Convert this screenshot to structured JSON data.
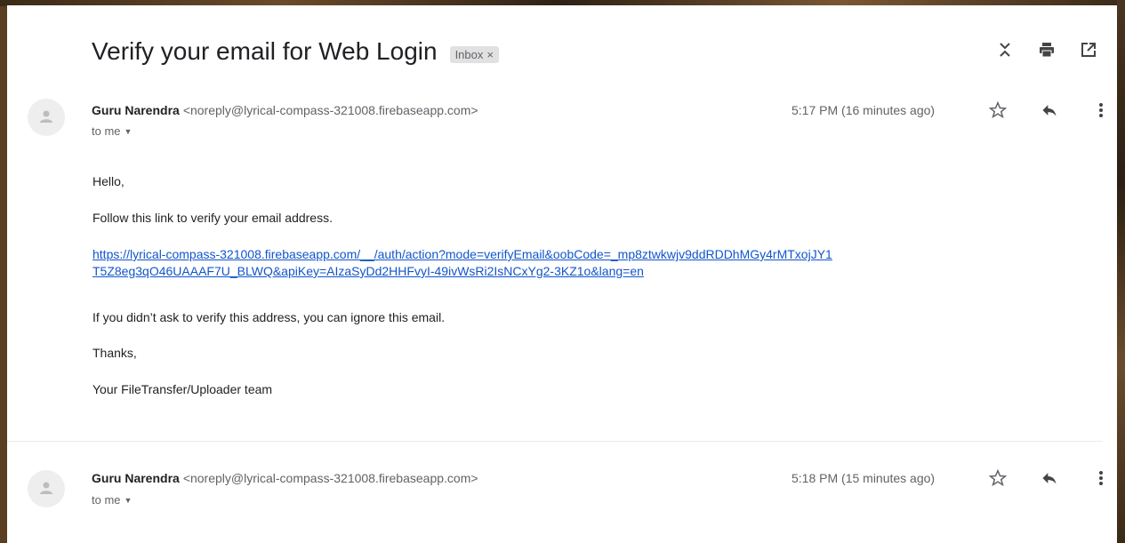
{
  "email": {
    "subject": "Verify your email for Web Login",
    "label": "Inbox",
    "label_close": "×"
  },
  "toolbar": {
    "icons": [
      "expand-collapse-icon",
      "print-icon",
      "open-in-new-window-icon"
    ]
  },
  "messages": [
    {
      "sender_name": "Guru Narendra",
      "sender_email": "<noreply@lyrical-compass-321008.firebaseapp.com>",
      "recipient": "to me",
      "time": "5:17 PM (16 minutes ago)",
      "body": {
        "greeting": "Hello,",
        "instruction": "Follow this link to verify your email address.",
        "link_line1": "https://lyrical-compass-321008.firebaseapp.com/__/auth/action?mode=verifyEmail&oobCode=_mp8ztwkwjv9ddRDDhMGy4rMTxojJY1",
        "link_line2": "T5Z8eg3qO46UAAAF7U_BLWQ&apiKey=AIzaSyDd2HHFvyI-49ivWsRi2IsNCxYg2-3KZ1o&lang=en",
        "ignore": "If you didn’t ask to verify this address, you can ignore this email.",
        "thanks": "Thanks,",
        "signature": "Your FileTransfer/Uploader team"
      }
    },
    {
      "sender_name": "Guru Narendra",
      "sender_email": "<noreply@lyrical-compass-321008.firebaseapp.com>",
      "recipient": "to me",
      "time": "5:18 PM (15 minutes ago)"
    }
  ],
  "colors": {
    "link": "#1155cc",
    "text": "#202124",
    "muted": "#5f6368",
    "chip": "#e1e1e1"
  }
}
